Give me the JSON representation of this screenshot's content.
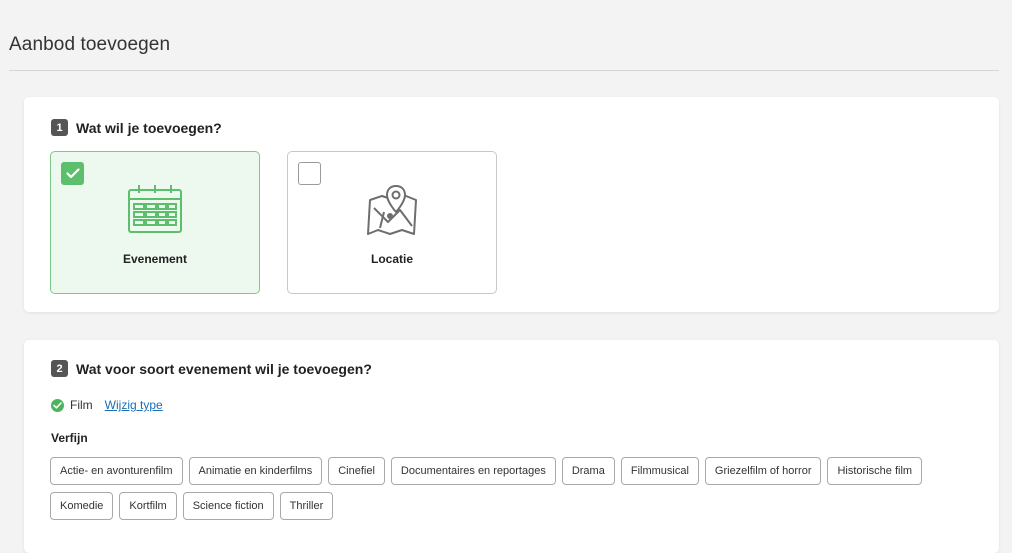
{
  "page": {
    "title": "Aanbod toevoegen"
  },
  "step1": {
    "number": "1",
    "heading": "Wat wil je toevoegen?",
    "options": [
      {
        "label": "Evenement",
        "icon": "calendar-icon",
        "selected": true
      },
      {
        "label": "Locatie",
        "icon": "map-pin-icon",
        "selected": false
      }
    ]
  },
  "step2": {
    "number": "2",
    "heading": "Wat voor soort evenement wil je toevoegen?",
    "selected_type": "Film",
    "change_link": "Wijzig type",
    "refine_label": "Verfijn",
    "tags": [
      "Actie- en avonturenfilm",
      "Animatie en kinderfilms",
      "Cinefiel",
      "Documentaires en reportages",
      "Drama",
      "Filmmusical",
      "Griezelfilm of horror",
      "Historische film",
      "Komedie",
      "Kortfilm",
      "Science fiction",
      "Thriller"
    ]
  },
  "colors": {
    "accent_green": "#5cbf6c",
    "selected_bg": "#edf9ef",
    "link_blue": "#1a6fb5"
  }
}
